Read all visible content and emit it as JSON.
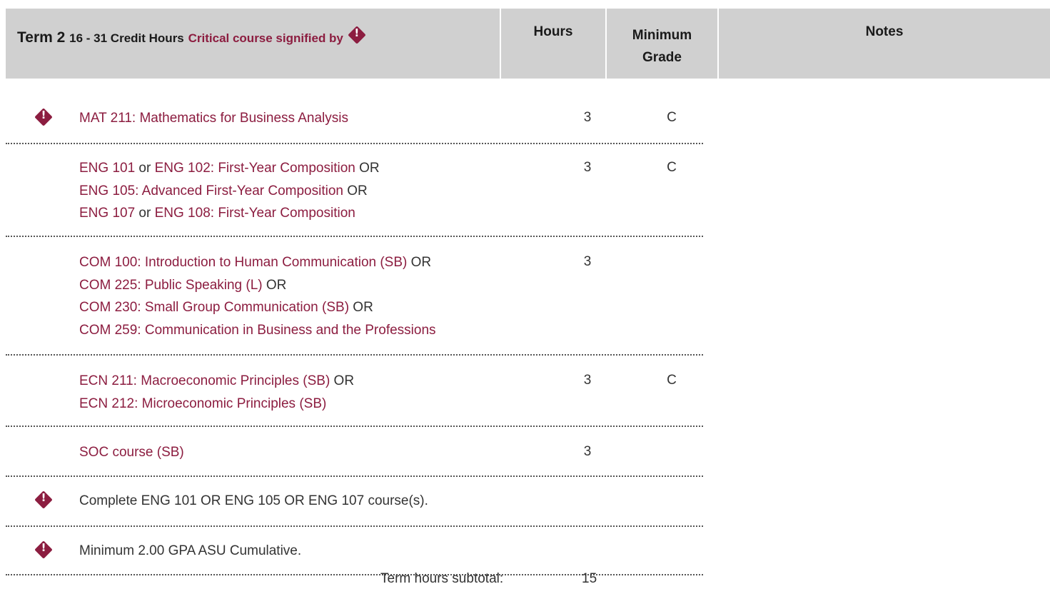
{
  "header": {
    "term": "Term 2",
    "credit_hours": "16 - 31 Credit Hours",
    "critical_note": "Critical course signified by",
    "col_hours": "Hours",
    "col_grade_line1": "Minimum",
    "col_grade_line2": "Grade",
    "col_notes": "Notes"
  },
  "rows": {
    "r0": {
      "c0": "MAT 211: Mathematics for Business Analysis",
      "hours": "3",
      "grade": "C"
    },
    "r1": {
      "c0": "ENG 101",
      "t0": " or ",
      "c1": "ENG 102: First-Year Composition",
      "t1": " OR",
      "c2": "ENG 105: Advanced First-Year Composition",
      "t2": " OR",
      "c3": "ENG 107",
      "t3": " or ",
      "c4": "ENG 108: First-Year Composition",
      "hours": "3",
      "grade": "C"
    },
    "r2": {
      "c0": "COM 100: Introduction to Human Communication (SB)",
      "t0": " OR",
      "c1": "COM 225: Public Speaking (L)",
      "t1": " OR",
      "c2": "COM 230: Small Group Communication (SB)",
      "t2": " OR",
      "c3": "COM 259: Communication in Business and the Professions",
      "hours": "3"
    },
    "r3": {
      "c0": "ECN 211: Macroeconomic Principles (SB)",
      "t0": " OR",
      "c1": "ECN 212: Microeconomic Principles (SB)",
      "hours": "3",
      "grade": "C"
    },
    "r4": {
      "c0": "SOC course (SB)",
      "hours": "3"
    },
    "r5": {
      "text": "Complete ENG 101 OR ENG 105 OR ENG 107 course(s)."
    },
    "r6": {
      "text": "Minimum 2.00 GPA ASU Cumulative."
    }
  },
  "subtotal": {
    "label": "Term hours subtotal:",
    "value": "15"
  },
  "colors": {
    "accent": "#8c1d40",
    "header_bg": "#d0d0d0",
    "text": "#333333"
  },
  "icons": {
    "critical": "critical-diamond-icon"
  }
}
